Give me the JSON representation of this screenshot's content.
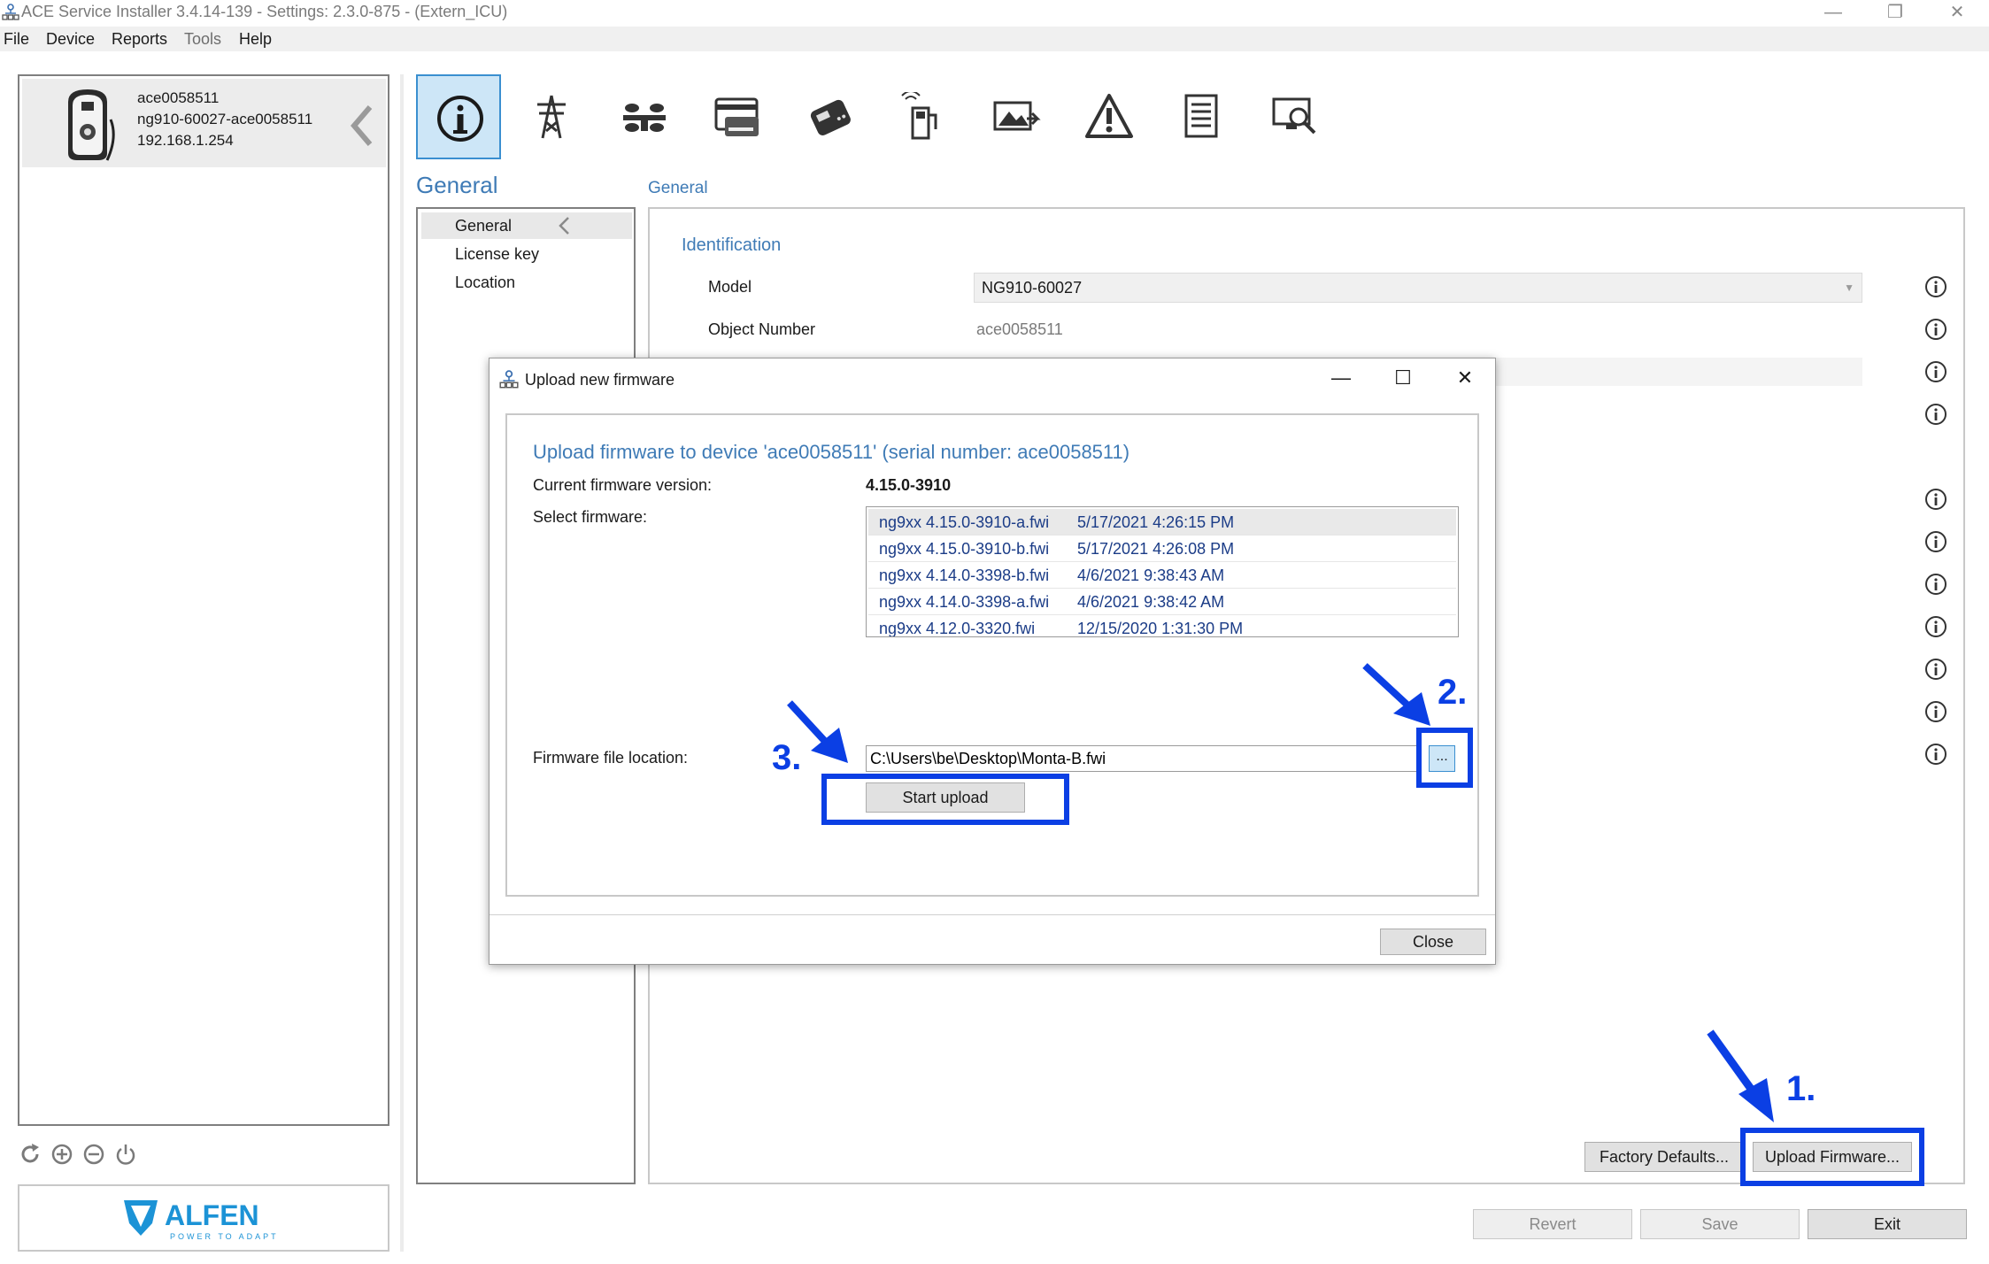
{
  "window": {
    "title": "ACE Service Installer 3.4.14-139 - Settings: 2.3.0-875 -  (Extern_ICU)",
    "minimize_glyph": "—",
    "restore_glyph": "❐",
    "close_glyph": "✕"
  },
  "menu": [
    {
      "label": "File",
      "enabled": true
    },
    {
      "label": "Device",
      "enabled": true
    },
    {
      "label": "Reports",
      "enabled": true
    },
    {
      "label": "Tools",
      "enabled": false
    },
    {
      "label": "Help",
      "enabled": true
    }
  ],
  "device": {
    "id": "ace0058511",
    "model_serial": "ng910-60027-ace0058511",
    "ip": "192.168.1.254"
  },
  "left_tools": [
    "refresh-icon",
    "add-circle-icon",
    "remove-circle-icon",
    "power-icon"
  ],
  "logo": {
    "brand": "ALFEN",
    "tagline": "POWER TO ADAPT"
  },
  "toolbar_tabs": [
    {
      "name": "info-icon",
      "active": true
    },
    {
      "name": "power-pylon-icon",
      "active": false
    },
    {
      "name": "load-balancing-icon",
      "active": false
    },
    {
      "name": "payment-card-icon",
      "active": false
    },
    {
      "name": "card-reader-icon",
      "active": false
    },
    {
      "name": "charging-station-icon",
      "active": false
    },
    {
      "name": "display-image-icon",
      "active": false
    },
    {
      "name": "warning-icon",
      "active": false
    },
    {
      "name": "document-icon",
      "active": false
    },
    {
      "name": "diagnostics-icon",
      "active": false
    }
  ],
  "section": {
    "title": "General",
    "nav": [
      {
        "label": "General",
        "selected": true
      },
      {
        "label": "License key",
        "selected": false
      },
      {
        "label": "Location",
        "selected": false
      }
    ]
  },
  "content": {
    "header": "General",
    "group": "Identification",
    "model_label": "Model",
    "model_value": "NG910-60027",
    "object_label": "Object Number",
    "object_value": "ace0058511"
  },
  "buttons": {
    "factory_defaults": "Factory Defaults...",
    "upload_firmware": "Upload Firmware...",
    "revert": "Revert",
    "save": "Save",
    "exit": "Exit"
  },
  "dialog": {
    "title": "Upload new firmware",
    "heading": "Upload firmware to device 'ace0058511' (serial number: ace0058511)",
    "current_label": "Current firmware version:",
    "current_value": "4.15.0-3910",
    "select_label": "Select firmware:",
    "firmware_list": [
      {
        "file": "ng9xx 4.15.0-3910-a.fwi",
        "date": "5/17/2021 4:26:15 PM",
        "selected": true
      },
      {
        "file": "ng9xx 4.15.0-3910-b.fwi",
        "date": "5/17/2021 4:26:08 PM",
        "selected": false
      },
      {
        "file": "ng9xx 4.14.0-3398-b.fwi",
        "date": "4/6/2021 9:38:43 AM",
        "selected": false
      },
      {
        "file": "ng9xx 4.14.0-3398-a.fwi",
        "date": "4/6/2021 9:38:42 AM",
        "selected": false
      },
      {
        "file": "ng9xx 4.12.0-3320.fwi",
        "date": "12/15/2020 1:31:30 PM",
        "selected": false
      }
    ],
    "location_label": "Firmware file location:",
    "location_value": "C:\\Users\\be\\Desktop\\Monta-B.fwi",
    "browse_label": "...",
    "start_upload": "Start upload",
    "close": "Close",
    "minimize_glyph": "—",
    "maximize_glyph": "☐",
    "close_glyph": "✕"
  },
  "annotations": {
    "step1": "1.",
    "step2": "2.",
    "step3": "3.",
    "color": "#0b3fe4"
  }
}
